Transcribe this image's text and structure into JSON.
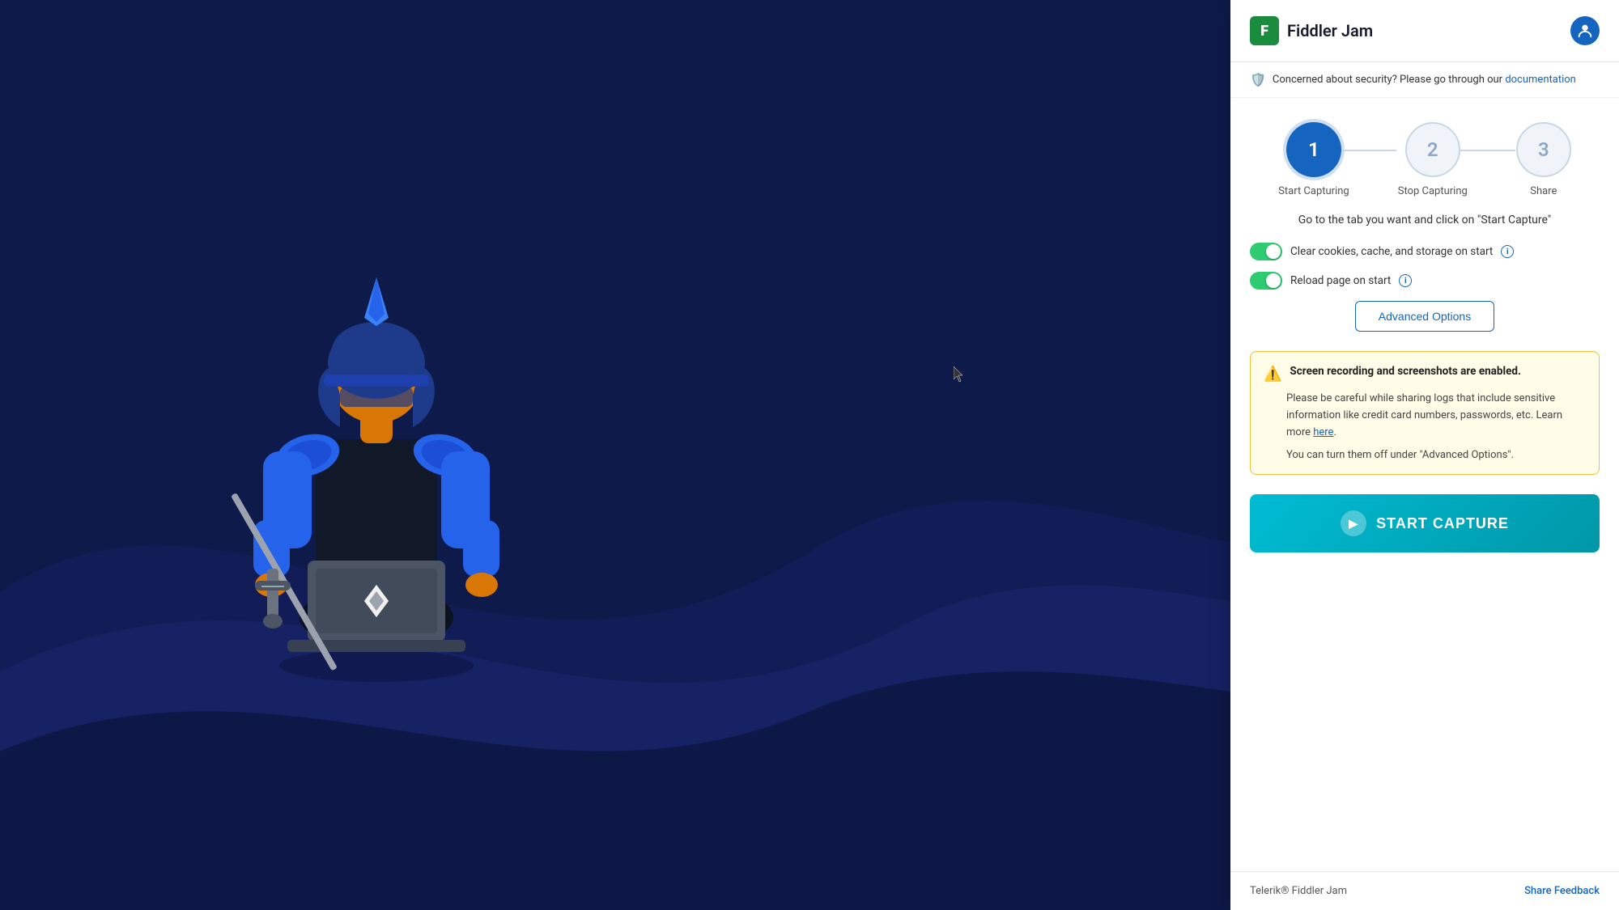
{
  "background": {
    "color": "#0e1a4a"
  },
  "header": {
    "logo_letter": "F",
    "title": "Fiddler Jam",
    "logo_bg": "#1b8c3e"
  },
  "security_banner": {
    "text": "Concerned about security? Please go through our ",
    "link_text": "documentation"
  },
  "steps": [
    {
      "number": "1",
      "label": "Start Capturing",
      "active": true
    },
    {
      "number": "2",
      "label": "Stop Capturing",
      "active": false
    },
    {
      "number": "3",
      "label": "Share",
      "active": false
    }
  ],
  "instruction": {
    "text": "Go to the tab you want and click on \"Start Capture\""
  },
  "toggles": [
    {
      "label": "Clear cookies, cache, and storage on start",
      "enabled": true
    },
    {
      "label": "Reload page on start",
      "enabled": true
    }
  ],
  "advanced_options": {
    "label": "Advanced Options"
  },
  "warning": {
    "title": "Screen recording and screenshots are enabled.",
    "body": "Please be careful while sharing logs that include sensitive information like credit card numbers, passwords, etc. Learn more ",
    "link_text": "here",
    "note": "You can turn them off under \"Advanced Options\"."
  },
  "start_capture": {
    "label": "START CAPTURE"
  },
  "footer": {
    "brand": "Telerik® Fiddler Jam",
    "feedback_link": "Share Feedback"
  }
}
